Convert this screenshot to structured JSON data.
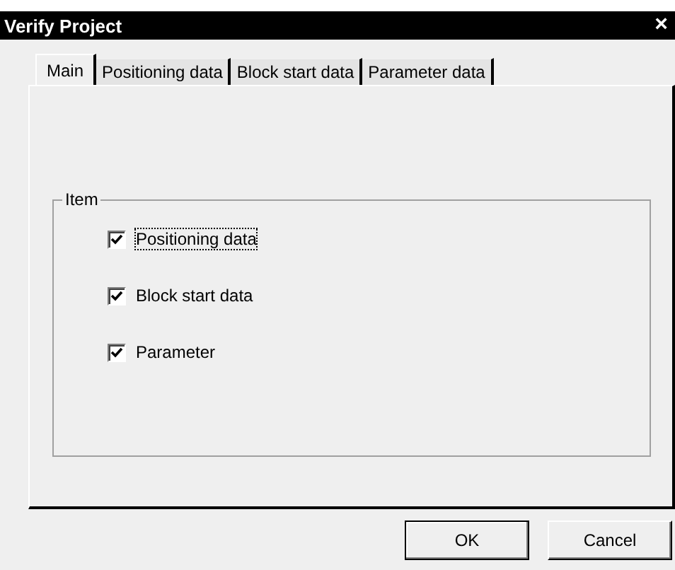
{
  "window": {
    "title": "Verify Project",
    "close": "×"
  },
  "tabs": [
    {
      "label": "Main",
      "selected": true
    },
    {
      "label": "Positioning data",
      "selected": false
    },
    {
      "label": "Block start data",
      "selected": false
    },
    {
      "label": "Parameter data",
      "selected": false
    }
  ],
  "group": {
    "title": "Item",
    "items": [
      {
        "label": "Positioning data",
        "checked": true,
        "focused": true
      },
      {
        "label": "Block start data",
        "checked": true,
        "focused": false
      },
      {
        "label": "Parameter",
        "checked": true,
        "focused": false
      }
    ]
  },
  "buttons": [
    {
      "label": "OK",
      "default": true
    },
    {
      "label": "Cancel",
      "default": false
    }
  ]
}
